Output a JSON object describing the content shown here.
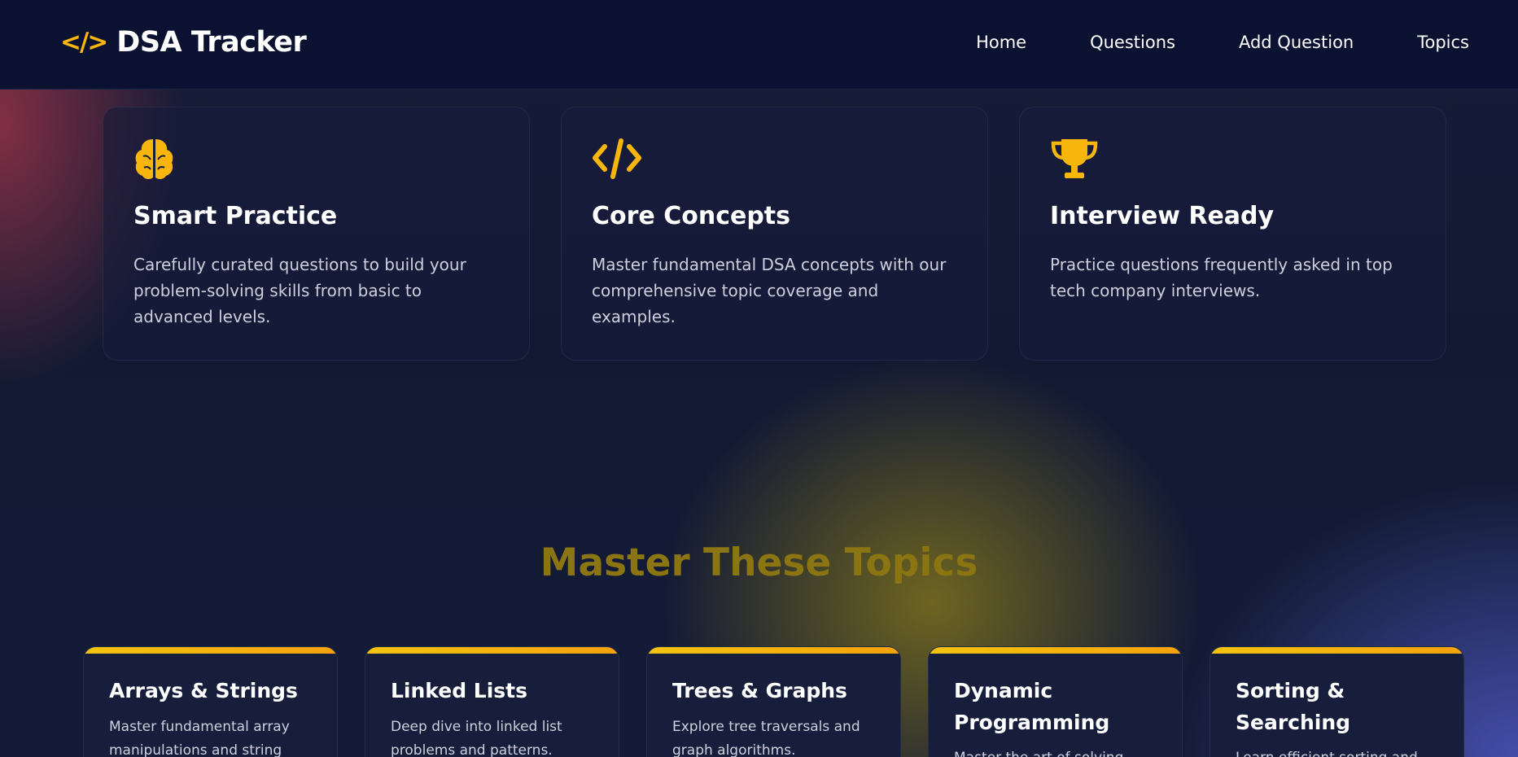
{
  "header": {
    "logo_icon": "</>",
    "logo_text": "DSA Tracker",
    "nav": [
      {
        "label": "Home"
      },
      {
        "label": "Questions"
      },
      {
        "label": "Add Question"
      },
      {
        "label": "Topics"
      }
    ]
  },
  "features": [
    {
      "icon": "brain-icon",
      "title": "Smart Practice",
      "description": "Carefully curated questions to build your problem-solving skills from basic to advanced levels."
    },
    {
      "icon": "code-icon",
      "title": "Core Concepts",
      "description": "Master fundamental DSA concepts with our comprehensive topic coverage and examples."
    },
    {
      "icon": "trophy-icon",
      "title": "Interview Ready",
      "description": "Practice questions frequently asked in top tech company interviews."
    }
  ],
  "topics_section": {
    "title": "Master These Topics",
    "topics": [
      {
        "title": "Arrays & Strings",
        "description": "Master fundamental array manipulations and string"
      },
      {
        "title": "Linked Lists",
        "description": "Deep dive into linked list problems and patterns."
      },
      {
        "title": "Trees & Graphs",
        "description": "Explore tree traversals and graph algorithms."
      },
      {
        "title": "Dynamic Programming",
        "description": "Master the art of solving"
      },
      {
        "title": "Sorting & Searching",
        "description": "Learn efficient sorting and"
      }
    ]
  },
  "colors": {
    "accent": "#f8b60d",
    "header_bg": "#0b1130",
    "page_bg": "#121a33",
    "section_title": "#8a7512"
  }
}
